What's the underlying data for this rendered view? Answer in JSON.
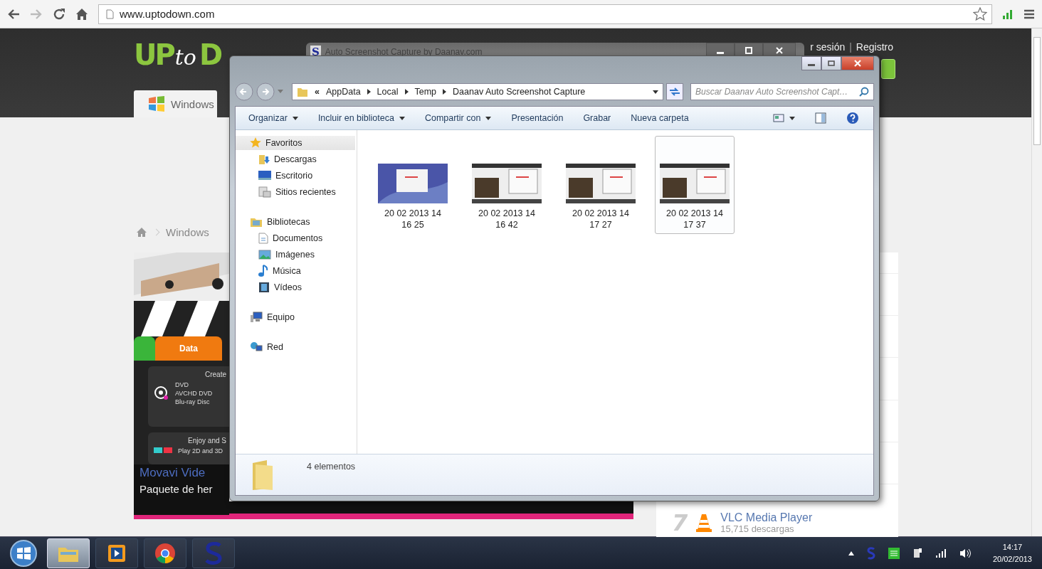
{
  "browser": {
    "url": "www.uptodown.com"
  },
  "site": {
    "logo": [
      {
        "text": "UP",
        "kind": "solid"
      },
      {
        "text": "to",
        "kind": "script"
      },
      {
        "text": "D",
        "kind": "solid"
      }
    ],
    "header_links": [
      "r sesión",
      "Registro"
    ],
    "header_separator": "|",
    "tab": "Windows",
    "breadcrumb": "Windows",
    "banner": {
      "tab": "Data",
      "cards": [
        {
          "title": "Create",
          "lines": [
            "DVD",
            "AVCHD DVD",
            "Blu-ray Disc"
          ]
        },
        {
          "title": "Enjoy and S",
          "lines": [
            "Play 2D and 3D"
          ]
        }
      ],
      "title": "Movavi Vide",
      "subtitle": "Paquete de her"
    },
    "ranking": [
      {
        "rank": "7",
        "name": "VLC Media Player",
        "downloads": "15,715 descargas"
      }
    ]
  },
  "background_window": {
    "icon_letter": "S",
    "title": "Auto Screenshot Capture by Daanav.com"
  },
  "explorer": {
    "overflow_mark": "«",
    "path": [
      "AppData",
      "Local",
      "Temp",
      "Daanav Auto Screenshot Capture"
    ],
    "search": {
      "placeholder": "Buscar Daanav Auto Screenshot Capt…"
    },
    "toolbar": [
      {
        "label": "Organizar",
        "dropdown": true
      },
      {
        "label": "Incluir en biblioteca",
        "dropdown": true
      },
      {
        "label": "Compartir con",
        "dropdown": true
      },
      {
        "label": "Presentación",
        "dropdown": false
      },
      {
        "label": "Grabar",
        "dropdown": false
      },
      {
        "label": "Nueva carpeta",
        "dropdown": false
      }
    ],
    "nav": [
      {
        "label": "Favoritos",
        "kind": "star",
        "selected": true,
        "children": [
          {
            "label": "Descargas",
            "kind": "download"
          },
          {
            "label": "Escritorio",
            "kind": "desktop"
          },
          {
            "label": "Sitios recientes",
            "kind": "recent"
          }
        ]
      },
      {
        "label": "Bibliotecas",
        "kind": "library",
        "selected": false,
        "children": [
          {
            "label": "Documentos",
            "kind": "document"
          },
          {
            "label": "Imágenes",
            "kind": "picture"
          },
          {
            "label": "Música",
            "kind": "music"
          },
          {
            "label": "Vídeos",
            "kind": "video"
          }
        ]
      },
      {
        "label": "Equipo",
        "kind": "computer",
        "selected": false
      },
      {
        "label": "Red",
        "kind": "network",
        "selected": false
      }
    ],
    "files": [
      {
        "name": "20 02 2013 14 16 25",
        "kind": "desktop",
        "selected": false
      },
      {
        "name": "20 02 2013 14 16 42",
        "kind": "browser",
        "selected": false
      },
      {
        "name": "20 02 2013 14 17 27",
        "kind": "browser",
        "selected": false
      },
      {
        "name": "20 02 2013 14 17 37",
        "kind": "browser",
        "selected": true
      }
    ],
    "status": "4 elementos"
  },
  "taskbar": {
    "items": [
      {
        "kind": "explorer",
        "selected": true
      },
      {
        "kind": "media",
        "selected": false
      },
      {
        "kind": "chrome",
        "selected": false
      },
      {
        "kind": "s-app",
        "selected": false
      }
    ],
    "time": "14:17",
    "date": "20/02/2013"
  }
}
